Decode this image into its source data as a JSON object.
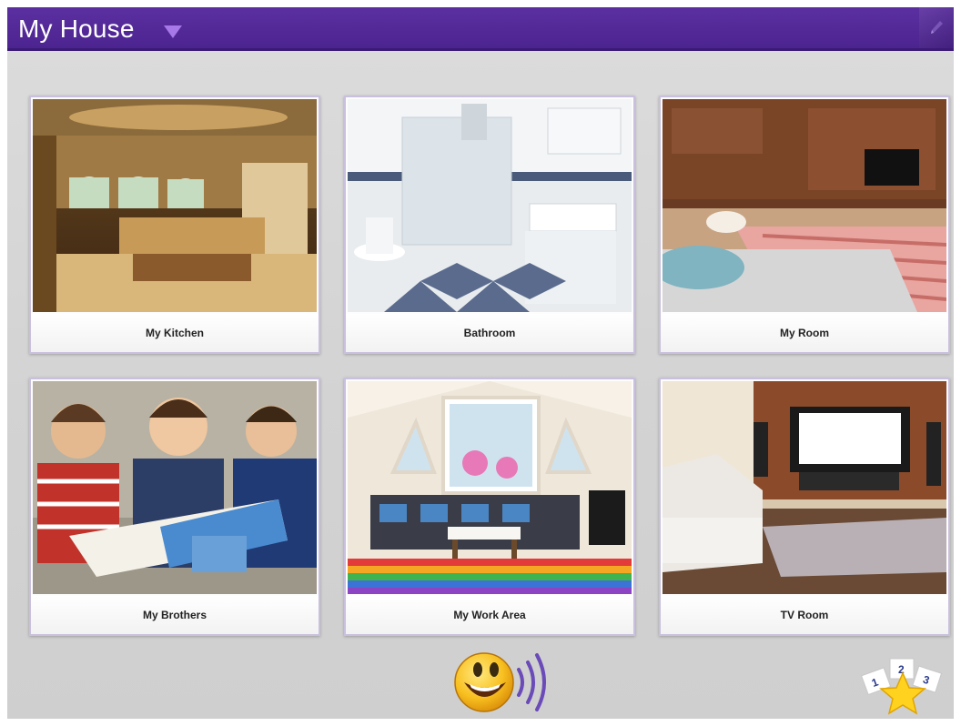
{
  "header": {
    "title": "My House",
    "dropdown_icon": "triangle-down-icon",
    "edit_icon": "pencil-icon",
    "bar_color": "#5b2fa0"
  },
  "tiles": [
    {
      "label": "My Kitchen"
    },
    {
      "label": "Bathroom"
    },
    {
      "label": "My Room"
    },
    {
      "label": "My Brothers"
    },
    {
      "label": "My Work Area"
    },
    {
      "label": "TV Room"
    }
  ],
  "footer": {
    "speak_icon": "smiley-speaking-icon",
    "star_cards": [
      "1",
      "2",
      "3"
    ]
  }
}
